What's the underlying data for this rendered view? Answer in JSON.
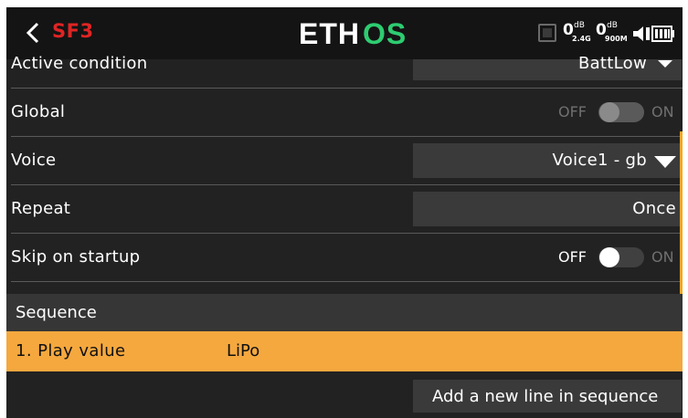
{
  "header": {
    "screen_title": "SF3",
    "brand": "ETHOS",
    "status": {
      "rssi_24": {
        "value": "0",
        "unit": "dB",
        "band": "2.4G"
      },
      "rssi_900": {
        "value": "0",
        "unit": "dB",
        "band": "900M"
      },
      "icons": [
        "module-icon",
        "signal-icon",
        "battery-icon"
      ]
    }
  },
  "settings": {
    "active_condition": {
      "label": "Active condition",
      "value": "BattLow"
    },
    "global": {
      "label": "Global",
      "off_label": "OFF",
      "on_label": "ON",
      "state": "off",
      "enabled": false
    },
    "voice": {
      "label": "Voice",
      "value": "Voice1 - gb"
    },
    "repeat": {
      "label": "Repeat",
      "value": "Once"
    },
    "skip_on_startup": {
      "label": "Skip on startup",
      "off_label": "OFF",
      "on_label": "ON",
      "state": "off",
      "enabled": true
    }
  },
  "sequence": {
    "title": "Sequence",
    "lines": [
      {
        "label": "1. Play value",
        "value": "LiPo"
      }
    ],
    "add_button": "Add a new line in sequence"
  },
  "colors": {
    "accent": "#f5a83e",
    "title_red": "#e02424",
    "background": "#222222",
    "field": "#3a3a3a"
  }
}
